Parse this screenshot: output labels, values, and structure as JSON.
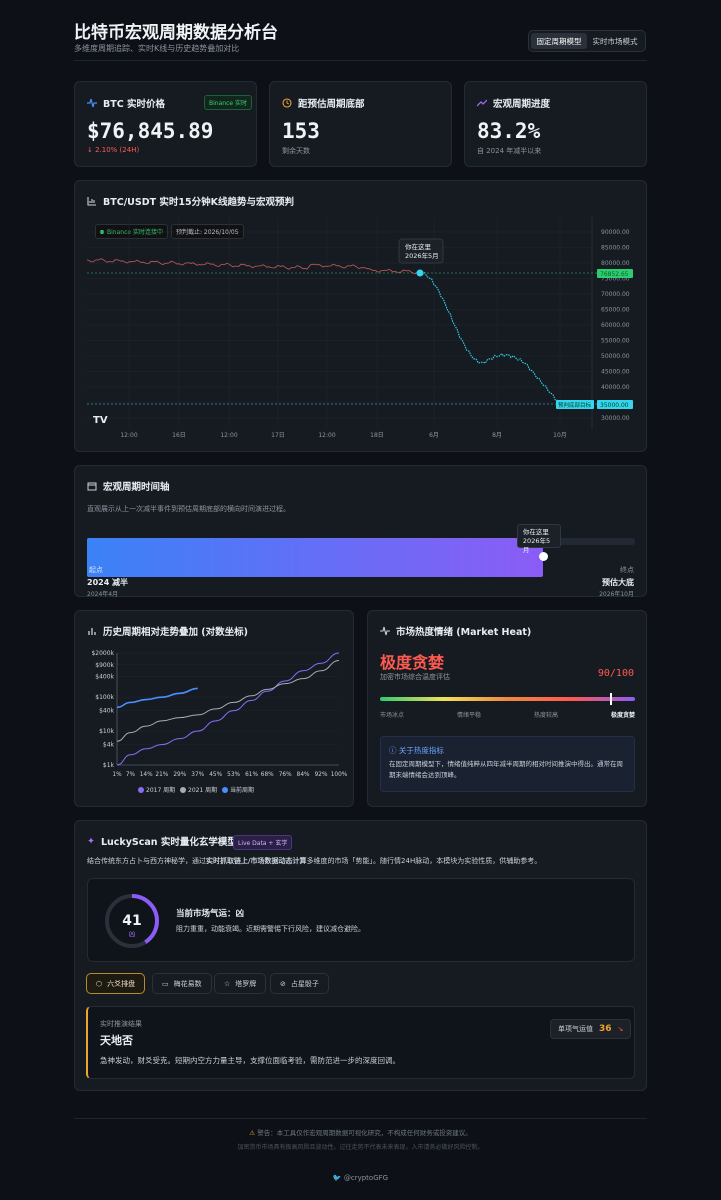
{
  "header": {
    "title": "比特币宏观周期数据分析台",
    "subtitle": "多维度周期追踪、实时K线与历史趋势叠加对比",
    "mode_fixed": "固定周期模型",
    "mode_live": "实时市场模式"
  },
  "stats": [
    {
      "label": "BTC 实时价格",
      "badge": "Binance 实时",
      "value": "$76,845.89",
      "note": "2.10% (24H)",
      "icon": "pulse-icon"
    },
    {
      "label": "距预估周期底部",
      "value": "153",
      "note": "剩余天数",
      "icon": "clock-icon"
    },
    {
      "label": "宏观周期进度",
      "value": "83.2%",
      "note": "自 2024 年减半以来",
      "icon": "trend-icon"
    }
  ],
  "kline": {
    "title": "BTC/USDT 实时15分钟K线趋势与宏观预判",
    "status": "Binance 实时连接中",
    "forecast": "预判截止: 2026/10/05",
    "marker_title": "你在这里",
    "marker_date": "2026年5月",
    "price_tag": "76852.65",
    "target_tag": "预判底部目标",
    "target_price": "35000.00",
    "logo": "TV",
    "y_labels": [
      "90000.00",
      "85000.00",
      "80000.00",
      "75000.00",
      "70000.00",
      "65000.00",
      "60000.00",
      "55000.00",
      "50000.00",
      "45000.00",
      "40000.00",
      "35000.00",
      "30000.00"
    ],
    "x_labels": [
      "12:00",
      "16日",
      "12:00",
      "17日",
      "12:00",
      "18日",
      "6月",
      "8月",
      "10月"
    ]
  },
  "timeline": {
    "title": "宏观周期时间轴",
    "desc": "直观展示从上一次减半事件到预估周期底部的横向时间演进过程。",
    "progress": 0.832,
    "marker_title": "你在这里",
    "marker_date": "2026年5月",
    "start_tag": "起点",
    "end_tag": "终点",
    "start_label": "2024 减半",
    "start_date": "2024年4月",
    "end_label": "预估大底",
    "end_date": "2026年10月"
  },
  "history": {
    "title": "历史周期相对走势叠加 (对数坐标)",
    "chart_data": {
      "type": "line",
      "title": "历史周期相对走势叠加 (对数坐标)",
      "y_scale": "log",
      "y_ticks": [
        "$2000k",
        "$900k",
        "$400k",
        "$100k",
        "$40k",
        "$10k",
        "$4k",
        "$1k"
      ],
      "x_ticks": [
        "1%",
        "7%",
        "14%",
        "21%",
        "29%",
        "37%",
        "45%",
        "53%",
        "61%",
        "68%",
        "76%",
        "84%",
        "92%",
        "100%"
      ],
      "series": [
        {
          "name": "2017 周期",
          "color": "#8b6cf6",
          "x": [
            1,
            7,
            14,
            21,
            29,
            37,
            45,
            53,
            61,
            68,
            76,
            84,
            92,
            100
          ],
          "y": [
            1,
            2,
            3,
            4,
            6,
            10,
            20,
            40,
            80,
            150,
            300,
            600,
            1000,
            2000
          ]
        },
        {
          "name": "2021 周期",
          "color": "#a7adb5",
          "x": [
            1,
            7,
            14,
            21,
            29,
            37,
            45,
            53,
            61,
            68,
            76,
            84,
            92,
            100
          ],
          "y": [
            5,
            9,
            14,
            20,
            25,
            30,
            45,
            70,
            110,
            170,
            250,
            350,
            600,
            1200
          ]
        },
        {
          "name": "当前周期",
          "color": "#4c8dff",
          "x": [
            1,
            7,
            14,
            21,
            29,
            37
          ],
          "y": [
            50,
            70,
            85,
            100,
            130,
            180
          ]
        }
      ]
    }
  },
  "heat": {
    "title": "市场热度情绪 (Market Heat)",
    "level": "极度贪婪",
    "desc": "加密市场综合温度评估",
    "score": "90/100",
    "value": 0.9,
    "scale": [
      "市场冰点",
      "情绪平稳",
      "热度较高",
      "极度贪婪"
    ],
    "info_title": "关于热度指标",
    "info_text": "在固定周期模型下，情绪值纯粹从四年减半周期的相对时间推演中得出。通常在周期末端情绪会达到顶峰。"
  },
  "lucky": {
    "title": "LuckyScan 实时量化玄学模型",
    "badge": "Live Data + 玄学",
    "intro_a": "结合传统东方占卜与西方神秘学，通过",
    "intro_b": "实时抓取链上/市场数据动态计算",
    "intro_c": "多维度的市场「势能」。随行情24H脉动，本模块为实验性质，供辅助参考。",
    "score": "41",
    "score_tag": "凶",
    "score_value": 0.41,
    "fortune_label": "当前市场气运：凶",
    "fortune_desc": "阻力重重，动能衰竭。近期需警惕下行风险，建议减仓避险。",
    "tabs": [
      "六爻排盘",
      "梅花易数",
      "塔罗牌",
      "占星骰子"
    ],
    "result_label": "实时推演结果",
    "result_title": "天地否",
    "single_label": "单项气运值",
    "single_value": "36",
    "result_text": "急神发动，财爻受克。短期内空方力量主导，支撑位面临考验，需防范进一步的深度回调。"
  },
  "footer": {
    "warning": "警告：本工具仅作宏观周期数据可视化研究，不构成任何财务或投资建议。",
    "note": "加密货币市场具有极高风险且波动性。过往走势不代表未来表现，入市请务必做好风险控制。",
    "handle": "@cryptoGFG"
  },
  "colors": {
    "bg": "#0d1117",
    "card": "#161b22",
    "accent": "#2ecc71",
    "red": "#ff5a4f",
    "cyan": "#35d6f0",
    "purple": "#8b5cf6"
  }
}
